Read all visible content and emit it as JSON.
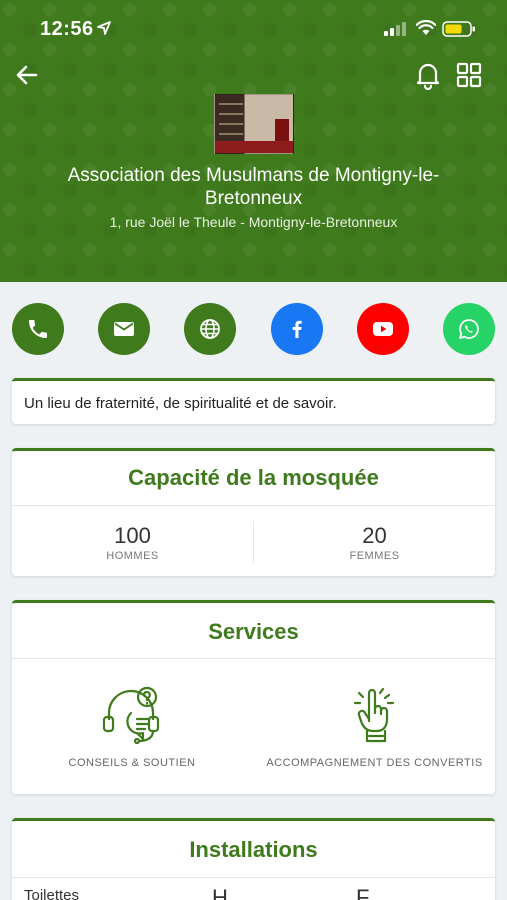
{
  "status_bar": {
    "time": "12:56"
  },
  "header": {
    "name": "Association des Musulmans de Montigny-le-Bretonneux",
    "address": "1, rue Joël le Theule - Montigny-le-Bretonneux"
  },
  "contact_buttons": [
    {
      "name": "phone",
      "color": "#3f7a1c"
    },
    {
      "name": "email",
      "color": "#3f7a1c"
    },
    {
      "name": "website",
      "color": "#3f7a1c"
    },
    {
      "name": "facebook",
      "color": "#1877f2"
    },
    {
      "name": "youtube",
      "color": "#ff0000"
    },
    {
      "name": "whatsapp",
      "color": "#25d366"
    }
  ],
  "tagline": "Un lieu de fraternité, de spiritualité et de savoir.",
  "capacity": {
    "title": "Capacité de la mosquée",
    "men": {
      "value": "100",
      "label": "HOMMES"
    },
    "women": {
      "value": "20",
      "label": "FEMMES"
    }
  },
  "services": {
    "title": "Services",
    "items": [
      {
        "label": "CONSEILS & SOUTIEN",
        "icon": "support-headset-icon"
      },
      {
        "label": "ACCOMPAGNEMENT DES CONVERTIS",
        "icon": "raised-finger-icon"
      }
    ]
  },
  "installations": {
    "title": "Installations",
    "row_partial": [
      "Toilettes",
      "H",
      "F"
    ]
  },
  "colors": {
    "brand": "#3f7a1c",
    "background": "#eef1f4"
  }
}
